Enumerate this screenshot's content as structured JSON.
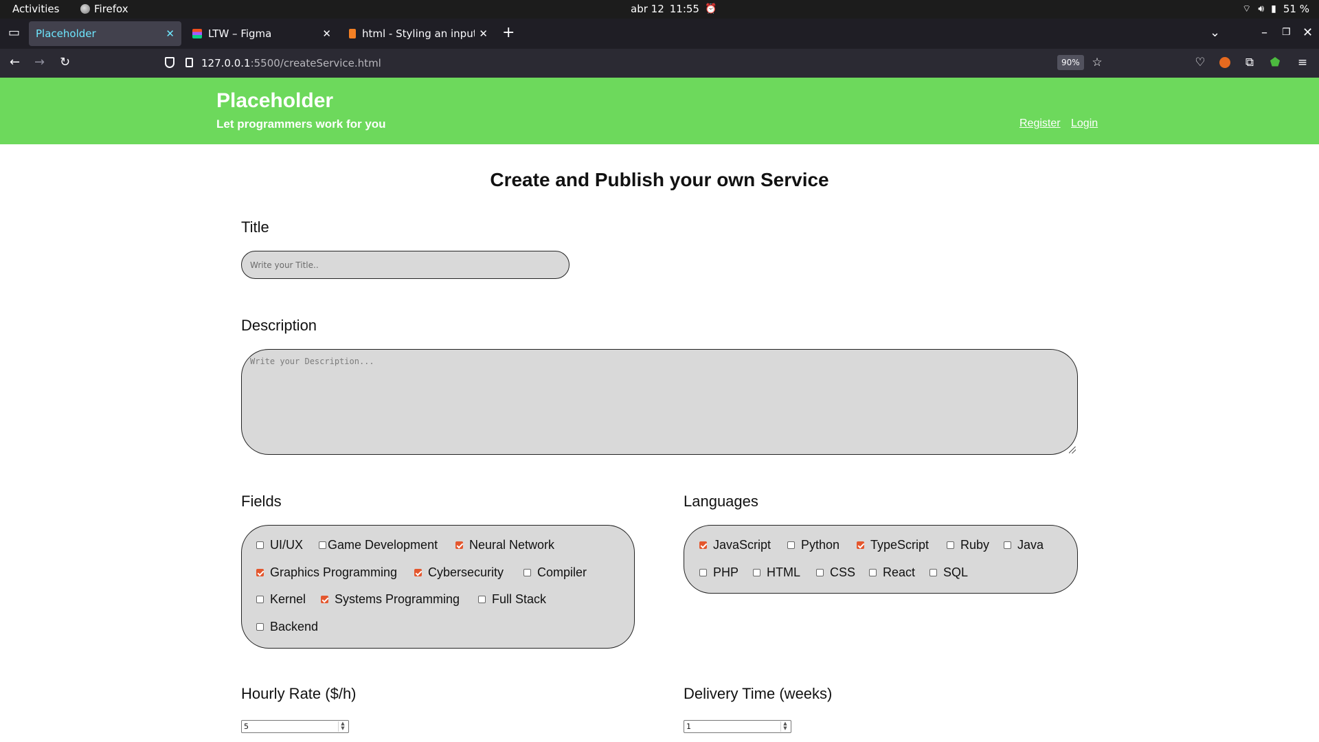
{
  "system_bar": {
    "activities": "Activities",
    "app_name": "Firefox",
    "date": "abr 12",
    "time": "11:55",
    "battery": "51 %"
  },
  "browser": {
    "tabs": [
      {
        "title": "Placeholder",
        "active": true
      },
      {
        "title": "LTW – Figma",
        "active": false
      },
      {
        "title": "html - Styling an input typ",
        "active": false
      }
    ],
    "url_host": "127.0.0.1",
    "url_path": ":5500/createService.html",
    "zoom": "90%"
  },
  "site": {
    "name": "Placeholder",
    "tagline": "Let programmers work for you",
    "nav": {
      "register": "Register",
      "login": "Login"
    },
    "header_color": "#6dd95c"
  },
  "form": {
    "heading": "Create and Publish your own Service",
    "title_label": "Title",
    "title_placeholder": "Write your Title..",
    "description_label": "Description",
    "description_placeholder": "Write your Description...",
    "fields_label": "Fields",
    "fields": [
      {
        "label": "UI/UX",
        "checked": false
      },
      {
        "label": "Game Development",
        "checked": false
      },
      {
        "label": "Neural Network",
        "checked": true
      },
      {
        "label": "Graphics Programming",
        "checked": true
      },
      {
        "label": "Cybersecurity",
        "checked": true
      },
      {
        "label": "Compiler",
        "checked": false
      },
      {
        "label": "Kernel",
        "checked": false
      },
      {
        "label": "Systems Programming",
        "checked": true
      },
      {
        "label": "Full Stack",
        "checked": false
      },
      {
        "label": "Backend",
        "checked": false
      }
    ],
    "languages_label": "Languages",
    "languages": [
      {
        "label": "JavaScript",
        "checked": true
      },
      {
        "label": "Python",
        "checked": false
      },
      {
        "label": "TypeScript",
        "checked": true
      },
      {
        "label": "Ruby",
        "checked": false
      },
      {
        "label": "Java",
        "checked": false
      },
      {
        "label": "PHP",
        "checked": false
      },
      {
        "label": "HTML",
        "checked": false
      },
      {
        "label": "CSS",
        "checked": false
      },
      {
        "label": "React",
        "checked": false
      },
      {
        "label": "SQL",
        "checked": false
      }
    ],
    "hourly_rate_label": "Hourly Rate ($/h)",
    "hourly_rate_value": "5",
    "delivery_label": "Delivery Time (weeks)",
    "delivery_value": "1"
  }
}
